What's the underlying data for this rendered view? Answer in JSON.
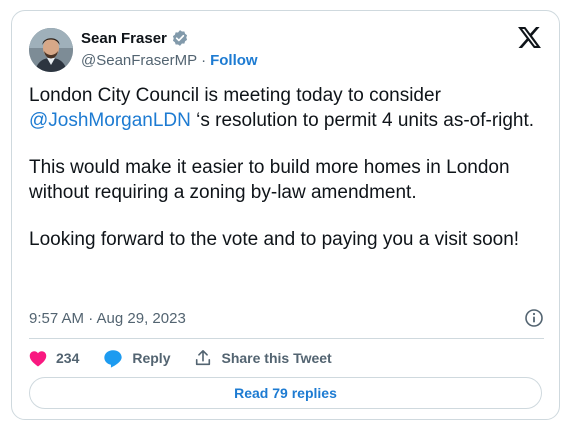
{
  "author": {
    "display_name": "Sean Fraser",
    "handle": "@SeanFraserMP",
    "separator": "·",
    "follow_label": "Follow",
    "verified": true
  },
  "tweet": {
    "line1_before": "London City Council is meeting today to consider ",
    "mention": "@JoshMorganLDN",
    "line1_after": " ‘s resolution to permit 4 units as-of-right.",
    "paragraph2": "This would make it easier to build more homes in London without requiring a zoning by-law amendment.",
    "paragraph3": "Looking forward to the vote and to paying you a visit soon!"
  },
  "meta": {
    "timestamp": "9:57 AM · Aug 29, 2023"
  },
  "actions": {
    "like_count": "234",
    "reply_label": "Reply",
    "share_label": "Share this Tweet"
  },
  "footer": {
    "read_replies_label": "Read 79 replies"
  },
  "colors": {
    "link": "#1d7bd2",
    "like": "#f91880",
    "reply": "#1d9bf0",
    "muted": "#536471",
    "border": "#cfd9de"
  },
  "icons": {
    "platform": "x-logo-icon",
    "verified": "verified-badge-icon",
    "info": "info-icon",
    "like": "heart-icon",
    "reply": "reply-bubble-icon",
    "share": "share-upload-icon"
  }
}
